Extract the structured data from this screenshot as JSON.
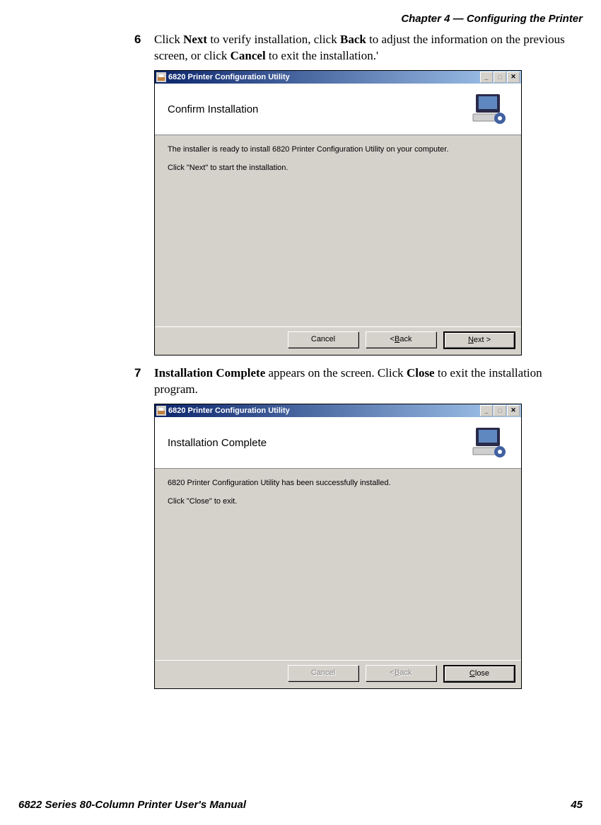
{
  "header": {
    "chapter": "Chapter 4 — Configuring the Printer"
  },
  "steps": {
    "s6": {
      "num": "6",
      "pre": "Click ",
      "b1": "Next",
      "mid1": " to verify installation, click ",
      "b2": "Back",
      "mid2": " to adjust the information on the previous screen, or click ",
      "b3": "Cancel",
      "post": " to exit the installation.'"
    },
    "s7": {
      "num": "7",
      "b1": "Installation Complete",
      "mid": " appears on the screen. Click ",
      "b2": "Close",
      "post": " to exit the installation program."
    }
  },
  "dialog1": {
    "title": "6820 Printer Configuration Utility",
    "heading": "Confirm Installation",
    "line1": "The installer is ready to install 6820 Printer Configuration Utility on your computer.",
    "line2": "Click \"Next\" to start the installation.",
    "buttons": {
      "cancel": "Cancel",
      "back_pre": "< ",
      "back_u": "B",
      "back_post": "ack",
      "next_u": "N",
      "next_post": "ext >"
    }
  },
  "dialog2": {
    "title": "6820 Printer Configuration Utility",
    "heading": "Installation Complete",
    "line1": "6820 Printer Configuration Utility has been successfully installed.",
    "line2": "Click \"Close\" to exit.",
    "buttons": {
      "cancel": "Cancel",
      "back_pre": "< ",
      "back_u": "B",
      "back_post": "ack",
      "close_u": "C",
      "close_post": "lose"
    }
  },
  "footer": {
    "manual": "6822 Series 80-Column Printer User's Manual",
    "page": "45"
  }
}
